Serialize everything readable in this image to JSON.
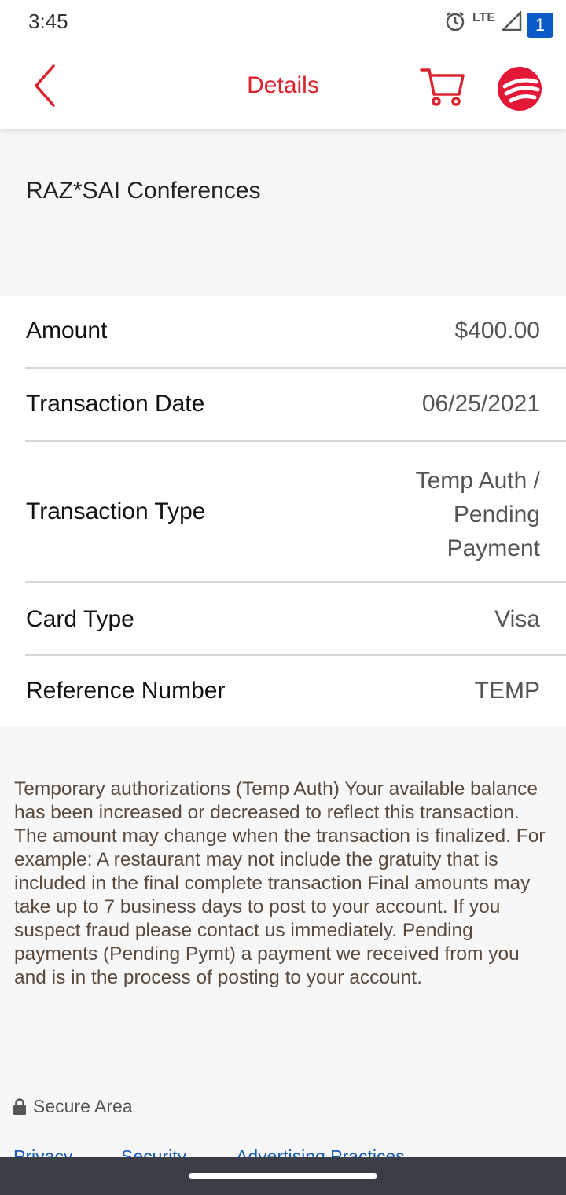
{
  "status_bar": {
    "time": "3:45",
    "network": "LTE"
  },
  "app_bar": {
    "title": "Details",
    "notification_count": "1"
  },
  "transaction": {
    "merchant": "RAZ*SAI Conferences",
    "rows": [
      {
        "label": "Amount",
        "value": "$400.00"
      },
      {
        "label": "Transaction Date",
        "value": "06/25/2021"
      },
      {
        "label": "Transaction Type",
        "value_lines": [
          "Temp Auth /",
          "Pending",
          "Payment"
        ]
      },
      {
        "label": "Card Type",
        "value": "Visa"
      },
      {
        "label": "Reference Number",
        "value": "TEMP"
      }
    ]
  },
  "disclaimer": "Temporary authorizations (Temp Auth) Your available balance has been increased or decreased to reflect this transaction. The amount may change when the transaction is finalized. For example: A restaurant may not include the gratuity that is included in the final complete transaction Final amounts may take up to 7 business days to post to your account. If you suspect fraud please contact us immediately. Pending payments (Pending Pymt) a payment we received from you and is in the process of posting to your account.",
  "secure_area": "Secure Area",
  "footer_links": [
    "Privacy",
    "Security",
    "Advertising Practices"
  ],
  "colors": {
    "brand_red": "#d9242f",
    "badge_blue": "#0a5ac8",
    "link_blue": "#1a5bb8"
  }
}
